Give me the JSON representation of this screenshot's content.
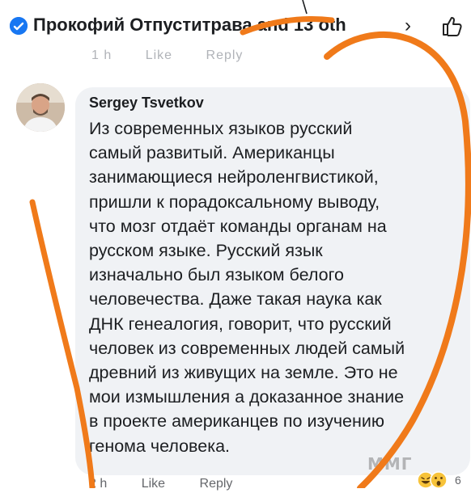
{
  "header": {
    "title": "Прокофий Отпуститрава and 13 oth",
    "chevron": "›",
    "chevron_icon": "chevron-right-icon",
    "like_icon": "thumbs-up-outline-icon"
  },
  "previous_comment_actions": {
    "time": "1 h",
    "like": "Like",
    "reply": "Reply"
  },
  "comment": {
    "author": "Sergey Tsvetkov",
    "avatar_icon": "avatar",
    "lines": [
      "Из современных языков русский",
      "самый развитый. Американцы",
      "занимающиеся нейроленгвистикой,",
      "пришли к порадоксальному выводу,",
      "что мозг отдаёт команды органам на",
      "русском языке. Русский язык",
      "изначально был языком белого",
      "человечества. Даже такая наука как",
      "ДНК генеалогия, говорит, что русский",
      "человек из современных людей самый",
      "древний из живущих на земле. Это не",
      "мои измышления а доказанное знание",
      "в проекте американцев по изучению",
      "генома человека."
    ],
    "actions": {
      "time": "2 h",
      "like": "Like",
      "reply": "Reply"
    },
    "reaction_count": "6",
    "reaction_icons": [
      "laughing-emoji-icon",
      "surprised-emoji-icon"
    ]
  },
  "watermark": "ММГ",
  "colors": {
    "accent": "#1877f2",
    "bubble": "#f0f2f5",
    "annotation": "#f07a1a"
  }
}
